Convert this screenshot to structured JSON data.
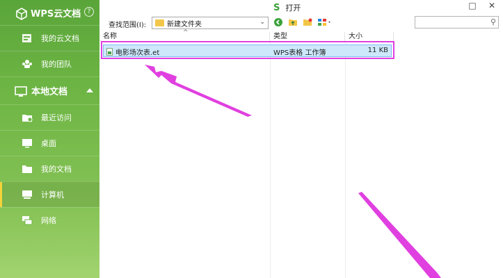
{
  "sidebar": {
    "title": "WPS云文档",
    "help": "?",
    "cloud_items": [
      {
        "label": "我的云文档"
      },
      {
        "label": "我的团队"
      }
    ],
    "local_section": "本地文档",
    "local_items": [
      {
        "label": "最近访问"
      },
      {
        "label": "桌面"
      },
      {
        "label": "我的文档"
      },
      {
        "label": "计算机",
        "active": true
      },
      {
        "label": "网络"
      }
    ]
  },
  "window": {
    "title": "打开",
    "app_mark": "S",
    "minimize": "□",
    "close": "✕"
  },
  "toolbar": {
    "scope_label": "查找范围(I):",
    "scope_value": "新建文件夹",
    "search_placeholder": ""
  },
  "columns": {
    "name": "名称",
    "type": "类型",
    "size": "大小"
  },
  "files": [
    {
      "name": "电影场次表.et",
      "type": "WPS表格 工作簿",
      "size": "11 KB"
    }
  ],
  "colors": {
    "sidebar_green": "#6cb443",
    "highlight": "#e040e0",
    "selection": "#cde8fb"
  }
}
